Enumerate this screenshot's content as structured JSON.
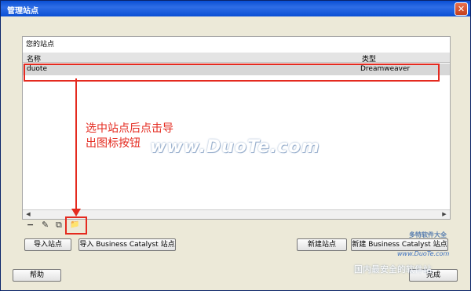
{
  "window": {
    "title": "管理站点"
  },
  "group": {
    "label": "您的站点"
  },
  "columns": {
    "name": "名称",
    "type": "类型"
  },
  "row": {
    "name": "duote",
    "type": "Dreamweaver"
  },
  "toolbar": {
    "delete": "−",
    "edit": "✎",
    "duplicate": "⧉",
    "export": "📁"
  },
  "buttons": {
    "import": "导入站点",
    "import_bc": "导入 Business Catalyst 站点",
    "new_site": "新建站点",
    "new_bc": "新建 Business Catalyst 站点",
    "help": "帮助",
    "done": "完成"
  },
  "annotation": {
    "line1": "选中站点后点击导",
    "line2": "出图标按钮"
  },
  "watermark": {
    "main": "www.DuoTe.com",
    "small1": "www.DuoTe.com",
    "small2": "国内最安全的软件站",
    "brand": "多特软件大全"
  },
  "colors": {
    "accent": "#e42a1f",
    "title_bar": "#0a4fd4"
  }
}
